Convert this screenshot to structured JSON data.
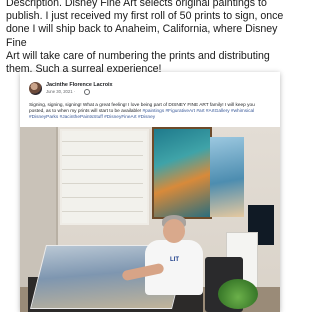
{
  "intro": {
    "text": "Description.  Disney Fine Art selects original paintings to\npublish.  I just received my first roll of 50 prints to sign, once\ndone I will ship back to Anaheim, California, where Disney Fine\nArt will take care of numbering the prints and distributing\nthem.  Such a surreal experience!"
  },
  "post": {
    "author": "Jacinthe Florence Lacroix",
    "date": "June 30, 2021 ·",
    "text": "Signing, signing, signing! What a great feeling! I love being part of DISNEY FINE ART family! I will keep you posted, as to when my prints will start to be available!",
    "hashtags": "#paintings #FigurativeArt #art #ArtGallery #whimsical #DisneyParks #JacinthePaintsStuff #DisneyFineArt #Disney",
    "photo_shirt_text": "LIT"
  }
}
